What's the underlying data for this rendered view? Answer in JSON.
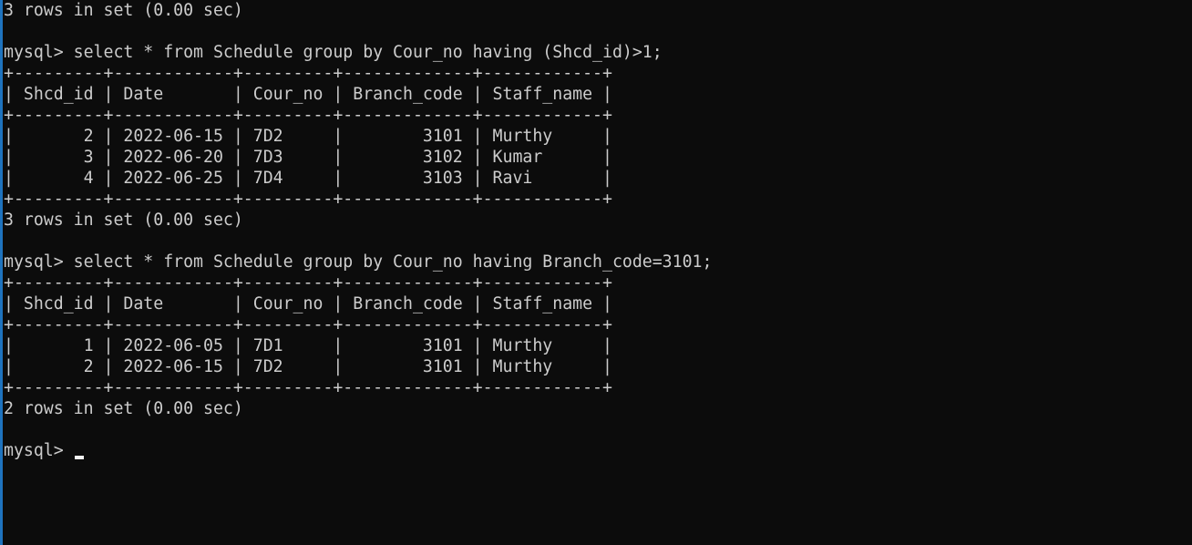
{
  "terminal": {
    "lines": [
      "3 rows in set (0.00 sec)",
      "",
      "mysql> select * from Schedule group by Cour_no having (Shcd_id)>1;",
      "+---------+------------+---------+-------------+------------+",
      "| Shcd_id | Date       | Cour_no | Branch_code | Staff_name |",
      "+---------+------------+---------+-------------+------------+",
      "|       2 | 2022-06-15 | 7D2     |        3101 | Murthy     |",
      "|       3 | 2022-06-20 | 7D3     |        3102 | Kumar      |",
      "|       4 | 2022-06-25 | 7D4     |        3103 | Ravi       |",
      "+---------+------------+---------+-------------+------------+",
      "3 rows in set (0.00 sec)",
      "",
      "mysql> select * from Schedule group by Cour_no having Branch_code=3101;",
      "+---------+------------+---------+-------------+------------+",
      "| Shcd_id | Date       | Cour_no | Branch_code | Staff_name |",
      "+---------+------------+---------+-------------+------------+",
      "|       1 | 2022-06-05 | 7D1     |        3101 | Murthy     |",
      "|       2 | 2022-06-15 | 7D2     |        3101 | Murthy     |",
      "+---------+------------+---------+-------------+------------+",
      "2 rows in set (0.00 sec)",
      ""
    ],
    "prompt": "mysql> ",
    "colors": {
      "background": "#0c0c0c",
      "text": "#cccccc",
      "cursor": "#f2f2f2",
      "window_edge": "#1e73be"
    }
  }
}
